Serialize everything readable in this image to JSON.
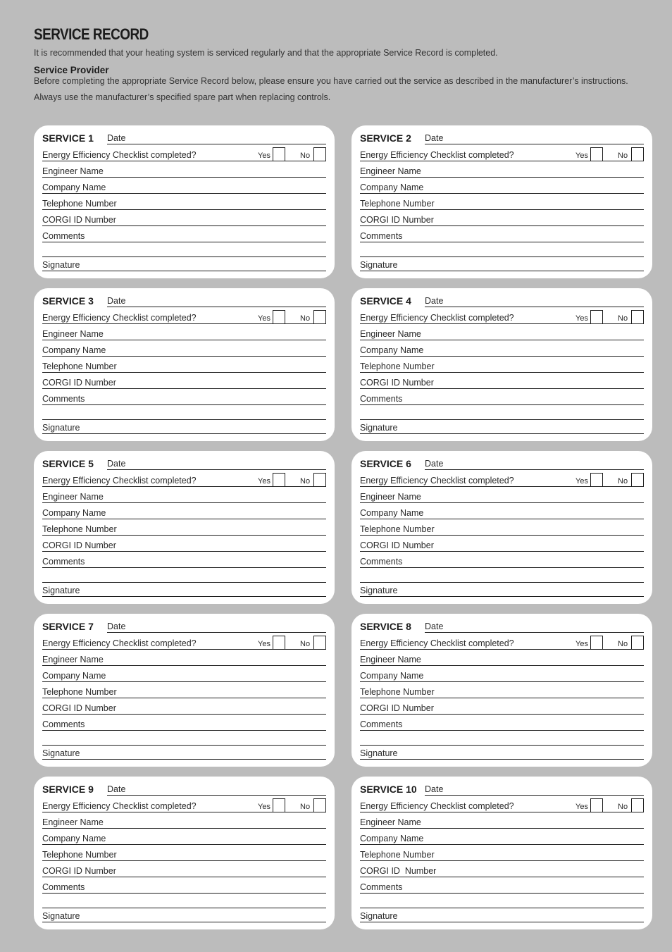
{
  "header": {
    "title": "SERVICE RECORD",
    "intro": "It is recommended that your heating system is serviced regularly and that the appropriate Service Record is completed.",
    "service_provider_heading": "Service Provider",
    "service_provider_text": "Before completing the appropriate Service Record below, please ensure you have carried out the service as described in the manufacturer’s instructions.",
    "spare_parts_text": "Always use the manufacturer’s specified spare part when replacing controls."
  },
  "labels": {
    "date": "Date",
    "checklist": "Energy Efficiency Checklist completed?",
    "yes": "Yes",
    "no": "No",
    "engineer_name": "Engineer Name",
    "company_name": "Company Name",
    "telephone_number": "Telephone Number",
    "comments": "Comments",
    "signature": "Signature"
  },
  "services": [
    {
      "title": "SERVICE 1",
      "corgi_label": "CORGI ID Number"
    },
    {
      "title": "SERVICE 2",
      "corgi_label": "CORGI ID Number"
    },
    {
      "title": "SERVICE 3",
      "corgi_label": "CORGI ID Number"
    },
    {
      "title": "SERVICE 4",
      "corgi_label": "CORGI ID Number"
    },
    {
      "title": "SERVICE 5",
      "corgi_label": "CORGI ID Number"
    },
    {
      "title": "SERVICE 6",
      "corgi_label": "CORGI ID Number"
    },
    {
      "title": "SERVICE 7",
      "corgi_label": "CORGI ID Number"
    },
    {
      "title": "SERVICE 8",
      "corgi_label": "CORGI ID Number"
    },
    {
      "title": "SERVICE 9",
      "corgi_label": "CORGI ID Number"
    },
    {
      "title": "SERVICE 10",
      "corgi_label": "CORGI ID  Number"
    }
  ]
}
